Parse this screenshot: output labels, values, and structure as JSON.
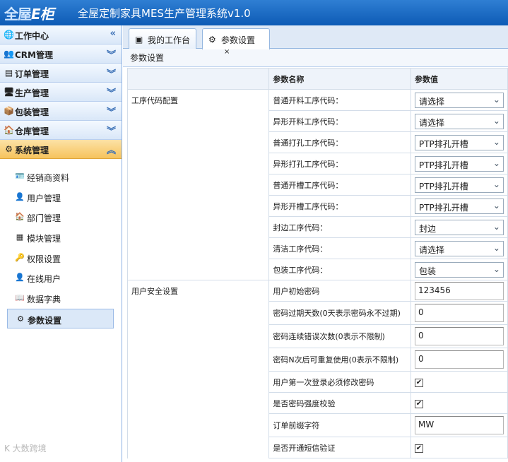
{
  "header": {
    "logo_text": "全屋",
    "logo_accent": "E柜",
    "title": "全屋定制家具MES生产管理系统v1.0"
  },
  "sidebar": {
    "sections": [
      {
        "label": "工作中心",
        "icon": "globe-icon",
        "chevron": "«"
      },
      {
        "label": "CRM管理",
        "icon": "users-icon",
        "chevron": "»"
      },
      {
        "label": "订单管理",
        "icon": "form-icon",
        "chevron": "»"
      },
      {
        "label": "生产管理",
        "icon": "monitor-icon",
        "chevron": "»"
      },
      {
        "label": "包装管理",
        "icon": "package-icon",
        "chevron": "»"
      },
      {
        "label": "仓库管理",
        "icon": "house-icon",
        "chevron": "»"
      },
      {
        "label": "系统管理",
        "icon": "gear-icon",
        "chevron": "«"
      }
    ],
    "subitems": [
      {
        "label": "经销商资料",
        "icon": "card-icon"
      },
      {
        "label": "用户管理",
        "icon": "user-icon"
      },
      {
        "label": "部门管理",
        "icon": "house-icon"
      },
      {
        "label": "模块管理",
        "icon": "grid-icon"
      },
      {
        "label": "权限设置",
        "icon": "key-icon"
      },
      {
        "label": "在线用户",
        "icon": "person-icon"
      },
      {
        "label": "数据字典",
        "icon": "book-icon"
      },
      {
        "label": "参数设置",
        "icon": "gear-icon"
      }
    ],
    "watermark": "K 大数跨境"
  },
  "tabs": {
    "workbench": "我的工作台",
    "params": "参数设置",
    "close": "×"
  },
  "panel": {
    "title": "参数设置"
  },
  "table": {
    "col_name": "参数名称",
    "col_value": "参数值",
    "cat1": "工序代码配置",
    "cat2": "用户安全设置",
    "rows": [
      {
        "name": "普通开料工序代码：",
        "value": "请选择"
      },
      {
        "name": "异形开料工序代码：",
        "value": "请选择"
      },
      {
        "name": "普通打孔工序代码：",
        "value": "PTP排孔开槽"
      },
      {
        "name": "异形打孔工序代码：",
        "value": "PTP排孔开槽"
      },
      {
        "name": "普通开槽工序代码：",
        "value": "PTP排孔开槽"
      },
      {
        "name": "异形开槽工序代码：",
        "value": "PTP排孔开槽"
      },
      {
        "name": "封边工序代码：",
        "value": "封边"
      },
      {
        "name": "清洁工序代码：",
        "value": "请选择"
      },
      {
        "name": "包装工序代码：",
        "value": "包装"
      },
      {
        "name": "用户初始密码",
        "value": "123456"
      },
      {
        "name": "密码过期天数(0天表示密码永不过期)",
        "value": "0"
      },
      {
        "name": "密码连续错误次数(0表示不限制)",
        "value": "0"
      },
      {
        "name": "密码N次后可重复使用(0表示不限制)",
        "value": "0"
      },
      {
        "name": "用户第一次登录必须修改密码",
        "value": "✔"
      },
      {
        "name": "是否密码强度校验",
        "value": "✔"
      },
      {
        "name": "订单前缀字符",
        "value": "MW"
      },
      {
        "name": "是否开通短信验证",
        "value": "✔"
      }
    ]
  }
}
